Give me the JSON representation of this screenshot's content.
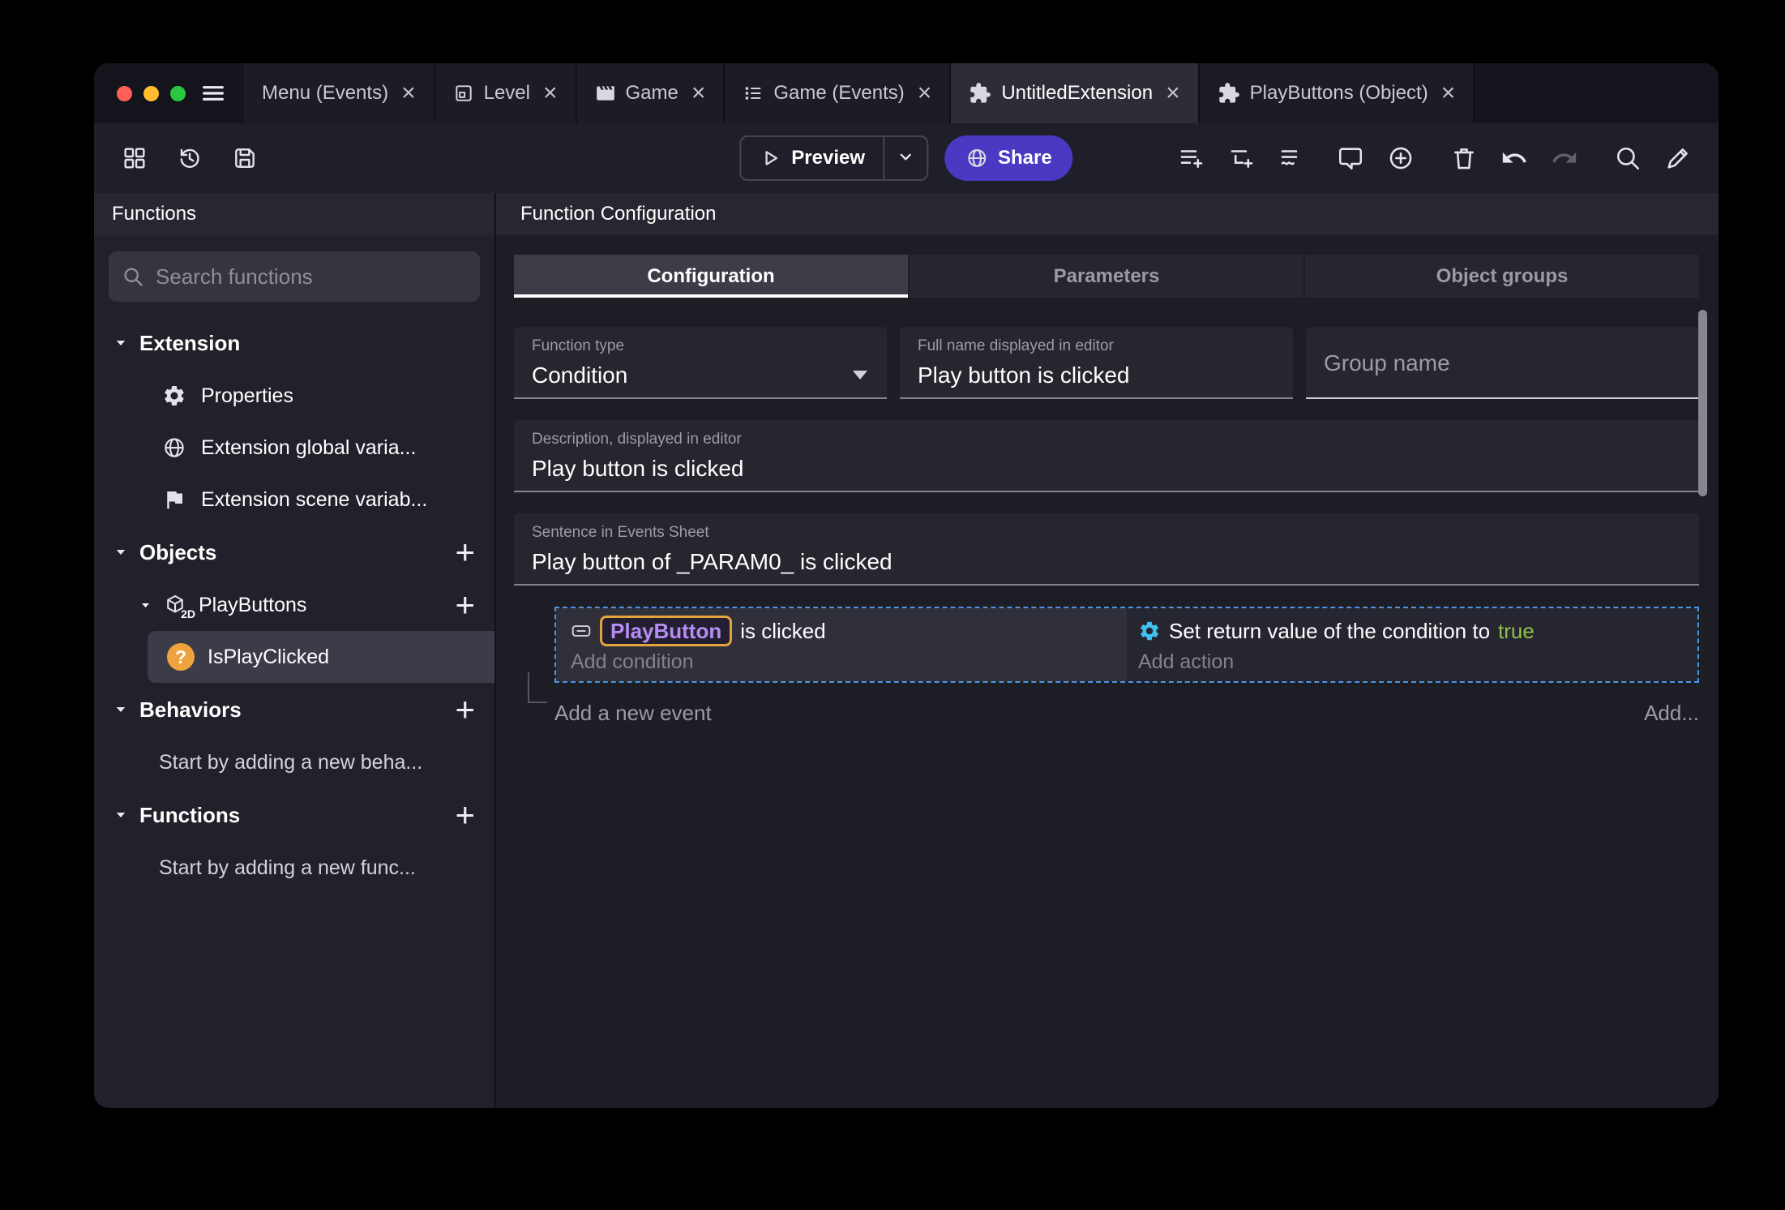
{
  "glyphs": {
    "close": "×",
    "plus": "+",
    "question": "?",
    "badge_2d": "2D"
  },
  "colors": {
    "accent_purple": "#4a39c2",
    "chip_text_purple": "#b58df2",
    "chip_border_orange": "#e2a43b",
    "true_green": "#8fc04a",
    "gear_blue": "#3fc1f2",
    "selection_dashed_blue": "#4d94e0",
    "function_icon_orange": "#efa33e"
  },
  "titlebar": {
    "tabs": [
      {
        "label": "Menu (Events)"
      },
      {
        "label": "Level"
      },
      {
        "label": "Game"
      },
      {
        "label": "Game (Events)"
      },
      {
        "label": "UntitledExtension"
      },
      {
        "label": "PlayButtons (Object)"
      }
    ]
  },
  "toolbar": {
    "preview": "Preview",
    "share": "Share"
  },
  "sidebar": {
    "header": "Functions",
    "search_placeholder": "Search functions",
    "extension_section": "Extension",
    "extension_items": [
      "Properties",
      "Extension global varia...",
      "Extension scene variab..."
    ],
    "objects_section": "Objects",
    "object_item": "PlayButtons",
    "function_item": "IsPlayClicked",
    "behaviors_section": "Behaviors",
    "behaviors_empty": "Start by adding a new beha...",
    "functions_section": "Functions",
    "functions_empty": "Start by adding a new func..."
  },
  "main": {
    "header": "Function Configuration",
    "tabs": [
      "Configuration",
      "Parameters",
      "Object groups"
    ],
    "function_type_label": "Function type",
    "function_type_value": "Condition",
    "full_name_label": "Full name displayed in editor",
    "full_name_value": "Play button is clicked",
    "group_name_placeholder": "Group name",
    "description_label": "Description, displayed in editor",
    "description_value": "Play button is clicked",
    "sentence_label": "Sentence in Events Sheet",
    "sentence_value": "Play button of _PARAM0_ is clicked"
  },
  "events": {
    "condition_object": "PlayButton",
    "condition_text": "is clicked",
    "add_condition": "Add condition",
    "action_text": "Set return value of the condition to",
    "action_value": "true",
    "add_action": "Add action",
    "add_event": "Add a new event",
    "add_button": "Add..."
  }
}
